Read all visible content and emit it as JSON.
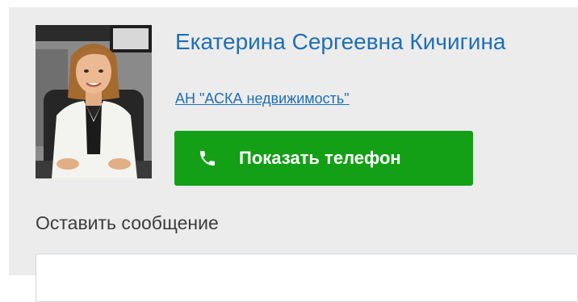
{
  "agent": {
    "name": "Екатерина Сергеевна Кичигина",
    "agency": "АН \"АСКА недвижимость\""
  },
  "actions": {
    "show_phone_label": "Показать телефон",
    "phone_icon": "phone-icon"
  },
  "message": {
    "heading": "Оставить сообщение"
  },
  "colors": {
    "link": "#1f6fb2",
    "button_green": "#13a016",
    "card_background": "#ececec"
  }
}
